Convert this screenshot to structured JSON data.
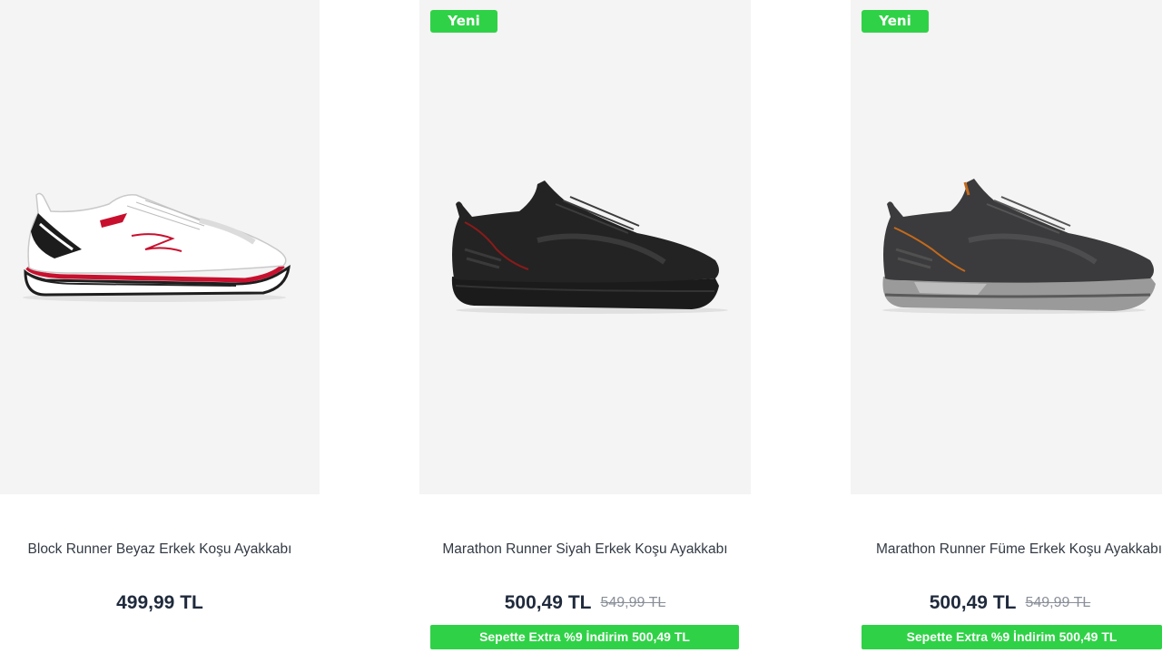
{
  "products": [
    {
      "name": "Block Runner Beyaz Erkek Koşu Ayakkabı",
      "price": "499,99 TL",
      "shoe_color": "white"
    },
    {
      "badge": "Yeni",
      "name": "Marathon Runner Siyah Erkek Koşu Ayakkabı",
      "price": "500,49 TL",
      "old_price": "549,99 TL",
      "promo": "Sepette Extra %9 İndirim 500,49 TL",
      "shoe_color": "black"
    },
    {
      "badge": "Yeni",
      "name": "Marathon Runner Füme Erkek Koşu Ayakkabı",
      "price": "500,49 TL",
      "old_price": "549,99 TL",
      "promo": "Sepette Extra %9 İndirim 500,49 TL",
      "shoe_color": "smoke-grey"
    }
  ],
  "colors": {
    "badge_green": "#2fd246",
    "image_bg": "#f4f4f4",
    "price_text": "#1f2a3c"
  }
}
